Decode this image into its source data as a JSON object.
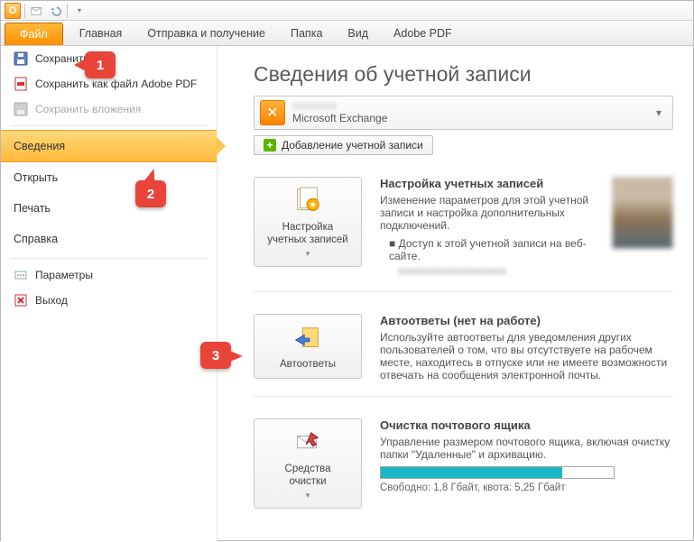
{
  "qat": {
    "o_label": "O"
  },
  "tabs": {
    "file": "Файл",
    "home": "Главная",
    "sendrecv": "Отправка и получение",
    "folder": "Папка",
    "view": "Вид",
    "adobe": "Adobe PDF"
  },
  "sidebar": {
    "save": "Сохранить",
    "save_pdf": "Сохранить как файл Adobe PDF",
    "save_attach": "Сохранить вложения",
    "info": "Сведения",
    "open": "Открыть",
    "print": "Печать",
    "help": "Справка",
    "options": "Параметры",
    "exit": "Выход"
  },
  "callouts": {
    "c1": "1",
    "c2": "2",
    "c3": "3"
  },
  "page": {
    "title": "Сведения об учетной записи",
    "account": {
      "line1_hidden": "xxxxxxxxx",
      "line2": "Microsoft Exchange"
    },
    "add_account": "Добавление учетной записи",
    "sections": {
      "acct": {
        "btn": "Настройка\nучетных записей",
        "hdr": "Настройка учетных записей",
        "body": "Изменение параметров для этой учетной записи и настройка дополнительных подключений.",
        "sub": "Доступ к этой учетной записи на веб-сайте.",
        "link": "xxxxxxxxxxxxxxxxxxxx"
      },
      "auto": {
        "btn": "Автоответы",
        "hdr": "Автоответы (нет на работе)",
        "body": "Используйте автоответы для уведомления других пользователей о том, что вы отсутствуете на рабочем месте, находитесь в отпуске или не имеете возможности отвечать на сообщения электронной почты."
      },
      "clean": {
        "btn": "Средства\nочистки",
        "hdr": "Очистка почтового ящика",
        "body": "Управление размером почтового ящика, включая очистку папки \"Удаленные\" и архивацию.",
        "storage": "Свободно: 1,8 Гбайт, квота: 5,25 Гбайт"
      }
    }
  }
}
